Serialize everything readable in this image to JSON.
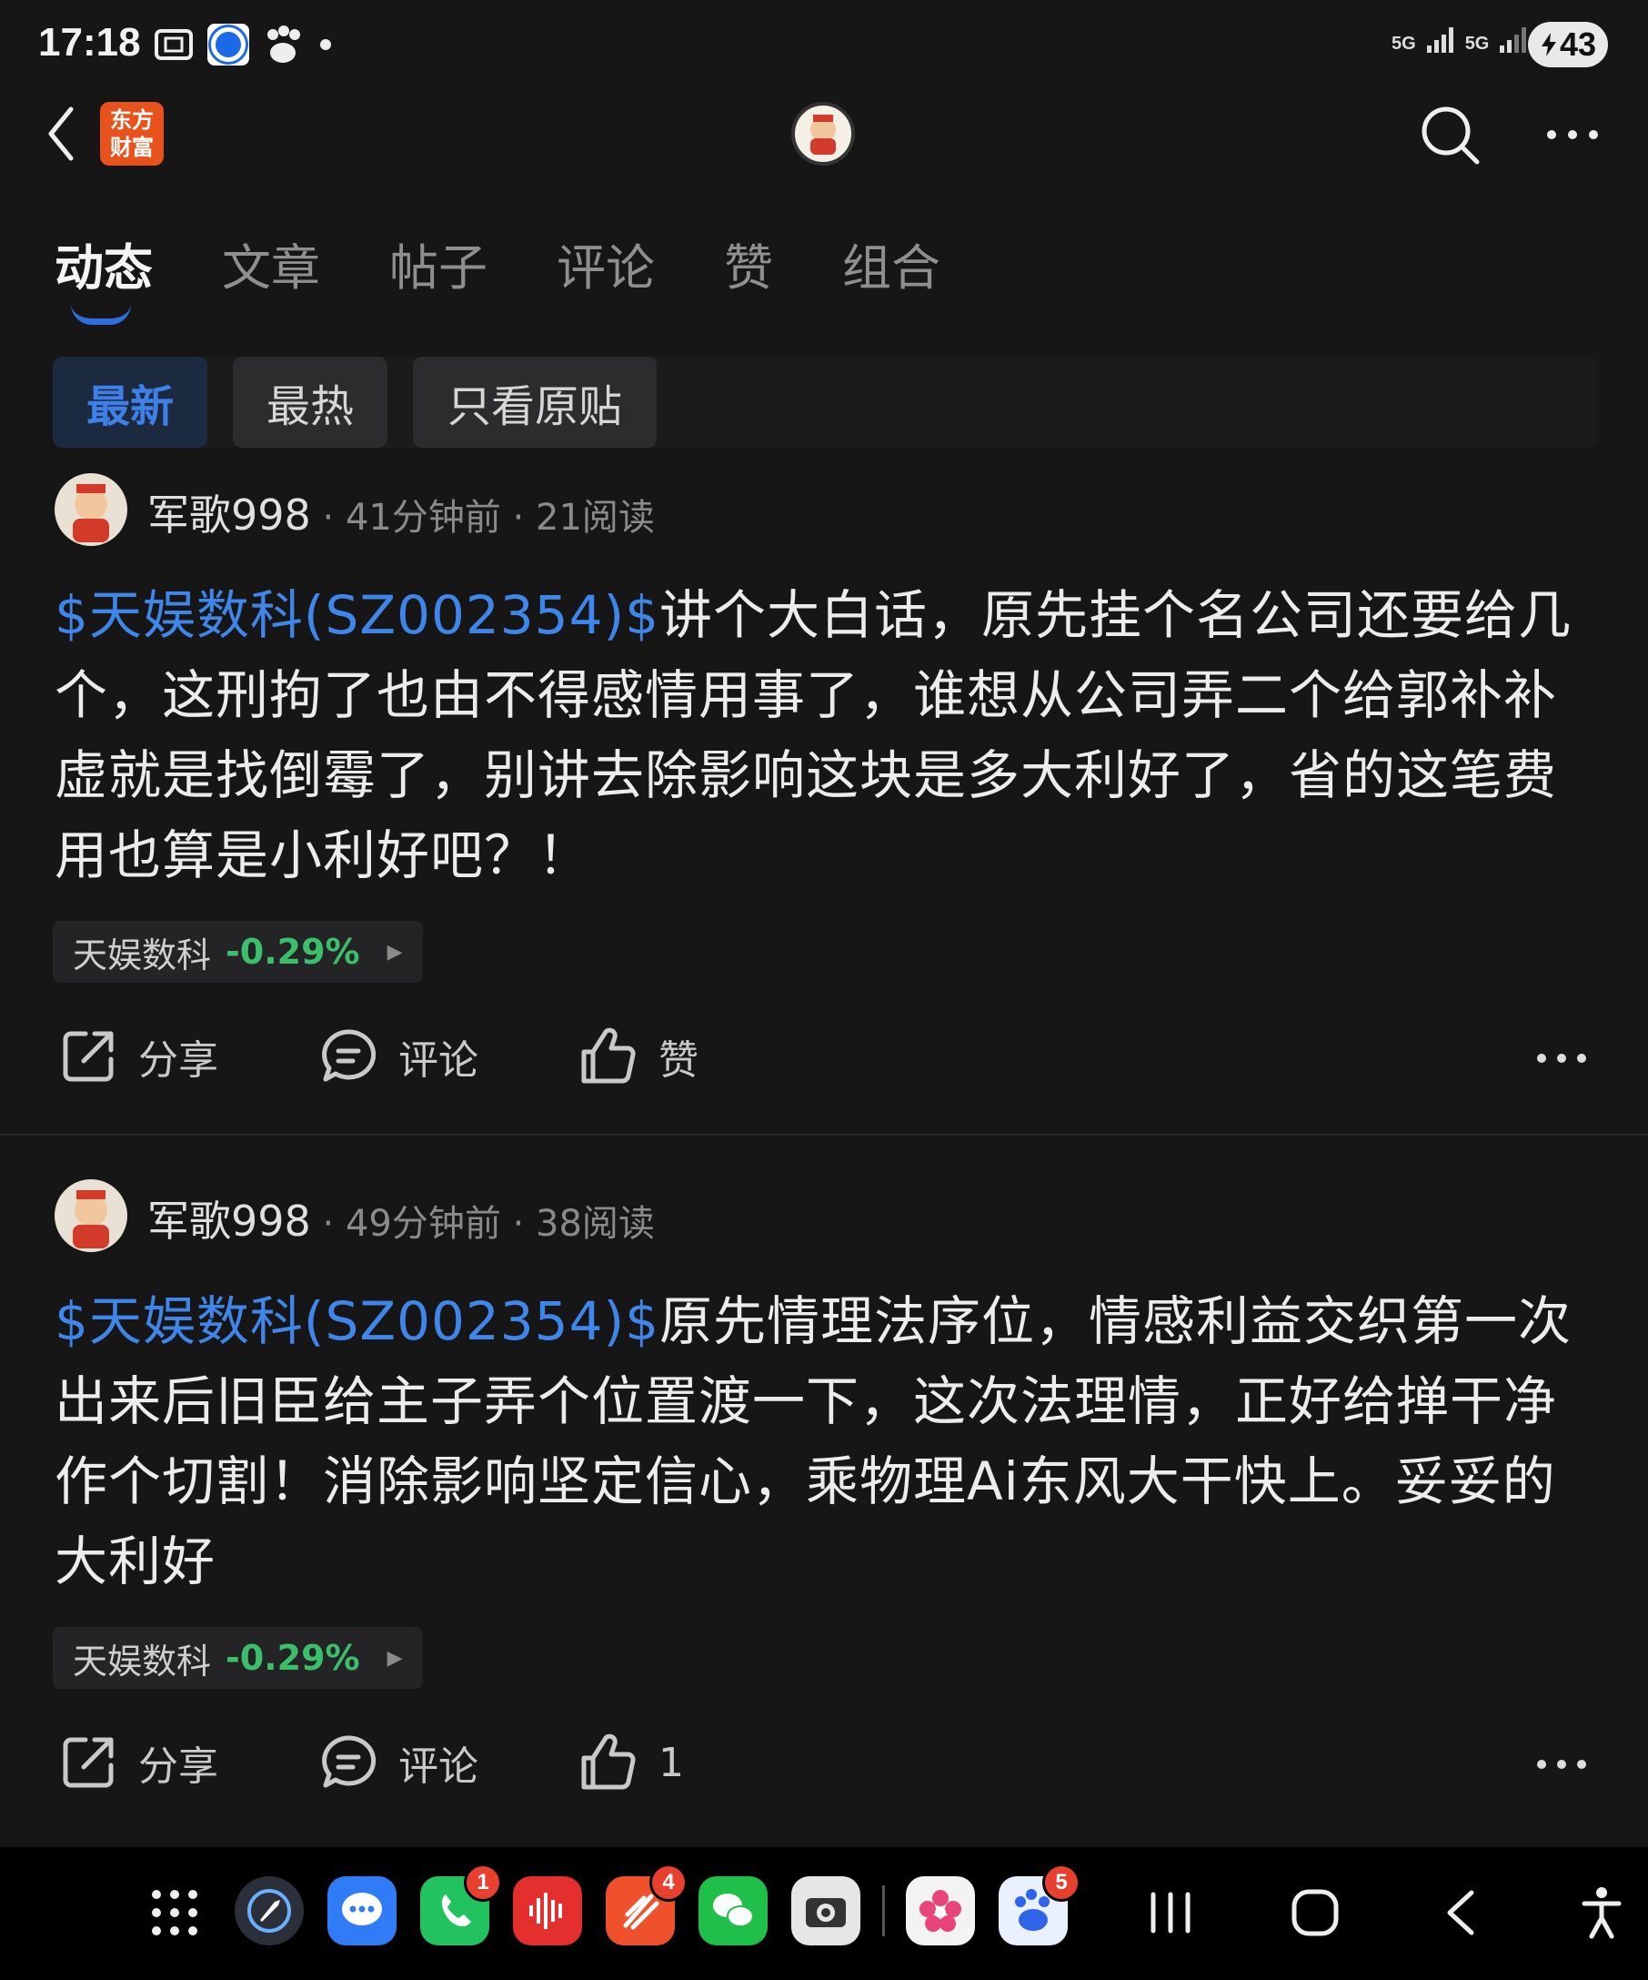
{
  "status_bar": {
    "time": "17:18",
    "battery": "43",
    "network_1": "5G",
    "network_2": "5G"
  },
  "top_nav": {
    "brand_line1": "东方",
    "brand_line2": "财富"
  },
  "tabs": [
    {
      "label": "动态",
      "active": true
    },
    {
      "label": "文章"
    },
    {
      "label": "帖子"
    },
    {
      "label": "评论"
    },
    {
      "label": "赞"
    },
    {
      "label": "组合"
    }
  ],
  "filters": [
    {
      "label": "最新",
      "active": true
    },
    {
      "label": "最热"
    },
    {
      "label": "只看原贴"
    }
  ],
  "posts": [
    {
      "author": "军歌998",
      "time": "41分钟前",
      "reads": "21阅读",
      "stock_link": "$天娱数科(SZ002354)$",
      "text": "讲个大白话，原先挂个名公司还要给几个，这刑拘了也由不得感情用事了，谁想从公司弄二个给郭补补虚就是找倒霉了，别讲去除影响这块是多大利好了，省的这笔费用也算是小利好吧？！",
      "stock_name": "天娱数科",
      "stock_change": "-0.29%",
      "actions": {
        "share": "分享",
        "comment": "评论",
        "like": "赞"
      }
    },
    {
      "author": "军歌998",
      "time": "49分钟前",
      "reads": "38阅读",
      "stock_link": "$天娱数科(SZ002354)$",
      "text": "原先情理法序位，情感利益交织第一次出来后旧臣给主子弄个位置渡一下，这次法理情，正好给掸干净作个切割！消除影响坚定信心，乘物理Ai东风大干快上。妥妥的大利好",
      "stock_name": "天娱数科",
      "stock_change": "-0.29%",
      "actions": {
        "share": "分享",
        "comment": "评论",
        "like": "1"
      }
    }
  ],
  "dock": {
    "badges": {
      "phone": "1",
      "app4": "4",
      "baidu": "5"
    }
  },
  "colors": {
    "background": "#161617",
    "accent": "#2e6fe0",
    "link": "#3f86ea",
    "negative": "#3bbf6a",
    "brand": "#e8531d"
  }
}
